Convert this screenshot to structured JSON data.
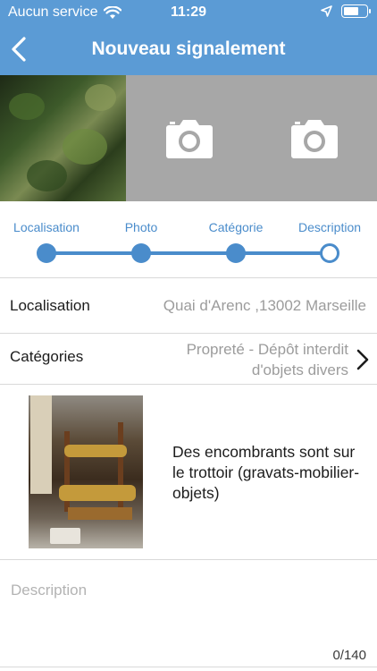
{
  "status_bar": {
    "carrier": "Aucun service",
    "time": "11:29"
  },
  "nav": {
    "title": "Nouveau signalement"
  },
  "photos": {
    "slots": [
      "photo",
      "empty",
      "empty"
    ]
  },
  "stepper": {
    "steps": [
      "Localisation",
      "Photo",
      "Catégorie",
      "Description"
    ],
    "current_index": 3
  },
  "form": {
    "location_label": "Localisation",
    "location_value": "Quai d'Arenc ,13002 Marseille",
    "categories_label": "Catégories",
    "categories_value": "Propreté - Dépôt interdit d'objets divers"
  },
  "report": {
    "text": "Des encombrants sont sur le trottoir (gravats-mobilier-objets)"
  },
  "description": {
    "placeholder": "Description",
    "counter": "0/140"
  },
  "colors": {
    "header": "#5b9bd5",
    "accent": "#4a8ccb",
    "photo_placeholder": "#a7a7a7"
  }
}
